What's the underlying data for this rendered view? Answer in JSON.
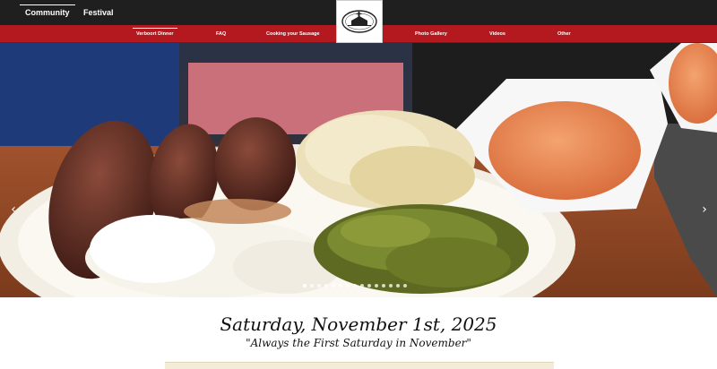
{
  "header": {
    "top_tabs": [
      {
        "label": "Community",
        "active": true
      },
      {
        "label": "Festival",
        "active": false
      }
    ]
  },
  "nav": {
    "items": [
      {
        "label": "Verboort Dinner",
        "active": true
      },
      {
        "label": "FAQ",
        "active": false
      },
      {
        "label": "Cooking your Sausage",
        "active": false
      },
      {
        "label": "Photo Gallery",
        "active": false
      },
      {
        "label": "Videos",
        "active": false
      },
      {
        "label": "Other",
        "active": false
      }
    ]
  },
  "hero": {
    "slide_count": 15,
    "active_slide": 1,
    "prev_icon": "chevron-left-icon",
    "next_icon": "chevron-right-icon"
  },
  "event": {
    "date": "Saturday, November 1st, 2025",
    "tagline": "\"Always the First Saturday in November\""
  },
  "colors": {
    "topbar": "#1f1f1f",
    "navbar": "#b3191e"
  }
}
